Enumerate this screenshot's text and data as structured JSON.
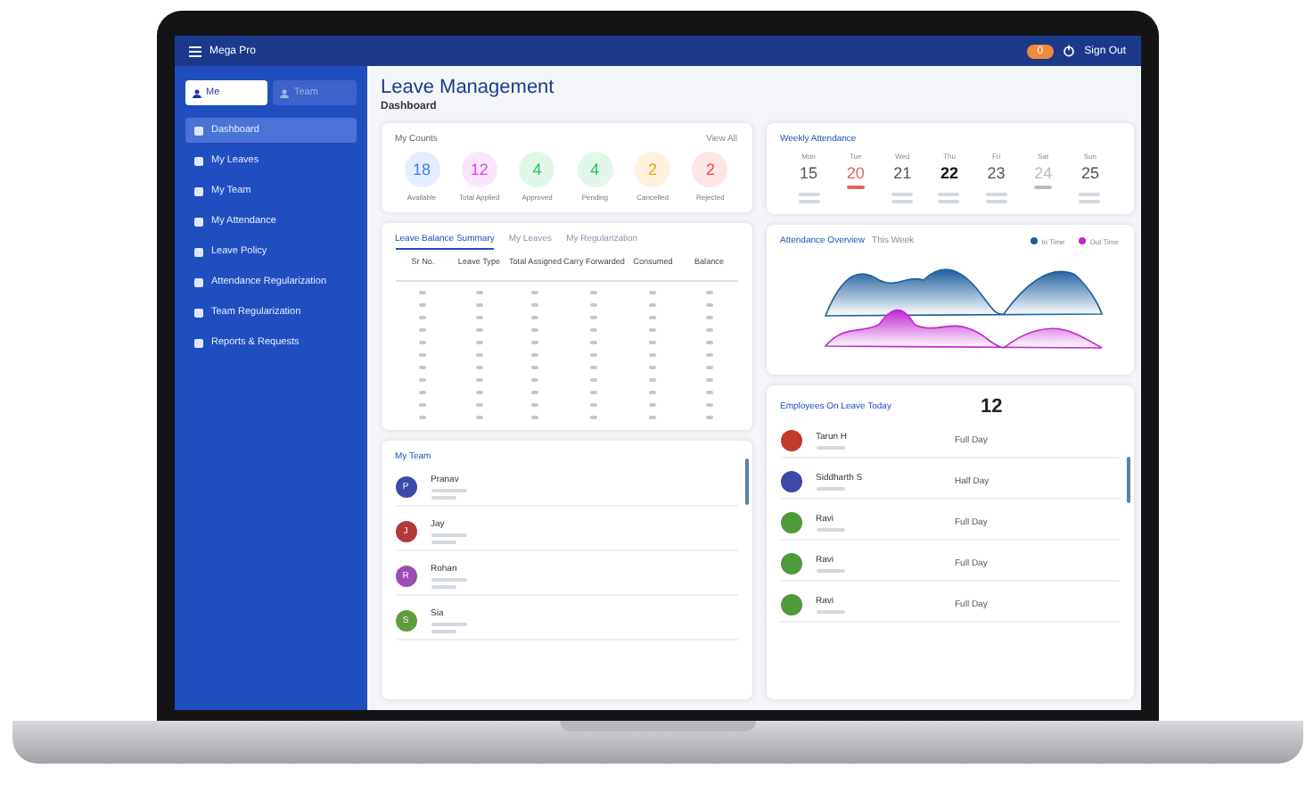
{
  "topbar": {
    "brand": "Mega Pro",
    "badge": "0",
    "user": "Sign Out"
  },
  "sidebar": {
    "toggle": [
      {
        "label": "Me",
        "selected": true
      },
      {
        "label": "Team",
        "selected": false
      }
    ],
    "items": [
      {
        "label": "Dashboard",
        "selected": true
      },
      {
        "label": "My Leaves",
        "selected": false
      },
      {
        "label": "My Team",
        "selected": false
      },
      {
        "label": "My Attendance",
        "selected": false
      },
      {
        "label": "Leave Policy",
        "selected": false
      },
      {
        "label": "Attendance Regularization",
        "selected": false
      },
      {
        "label": "Team Regularization",
        "selected": false
      },
      {
        "label": "Reports & Requests",
        "selected": false
      }
    ]
  },
  "page": {
    "title": "Leave Management",
    "subtitle": "Dashboard"
  },
  "counts": {
    "title": "My Counts",
    "action": "View All",
    "items": [
      {
        "value": "18",
        "label": "Available",
        "color": "#3b82f6"
      },
      {
        "value": "12",
        "label": "Total Applied",
        "color": "#d946ef"
      },
      {
        "value": "4",
        "label": "Approved",
        "color": "#22c55e"
      },
      {
        "value": "4",
        "label": "Pending",
        "color": "#22c55e"
      },
      {
        "value": "2",
        "label": "Cancelled",
        "color": "#f59e0b"
      },
      {
        "value": "2",
        "label": "Rejected",
        "color": "#ef4444"
      }
    ]
  },
  "summary": {
    "tabs": [
      {
        "label": "Leave Balance Summary",
        "selected": true
      },
      {
        "label": "My Leaves",
        "selected": false
      },
      {
        "label": "My Regularization",
        "selected": false
      }
    ],
    "columns": [
      "Sr No.",
      "Leave Type",
      "Total Assigned",
      "Carry Forwarded",
      "Consumed",
      "Balance"
    ]
  },
  "team": {
    "title": "My Team",
    "members": [
      {
        "initial": "P",
        "name": "Pranav",
        "color": "#3b4aa8"
      },
      {
        "initial": "J",
        "name": "Jay",
        "color": "#b23a3a"
      },
      {
        "initial": "R",
        "name": "Rohan",
        "color": "#9b4db3"
      },
      {
        "initial": "S",
        "name": "Sia",
        "color": "#5f9e3e"
      }
    ]
  },
  "weekly": {
    "title": "Weekly Attendance",
    "days": [
      {
        "day": "Mon",
        "date": "15",
        "kind": "present"
      },
      {
        "day": "Tue",
        "date": "20",
        "kind": "leave"
      },
      {
        "day": "Wed",
        "date": "21",
        "kind": "present"
      },
      {
        "day": "Thu",
        "date": "22",
        "kind": "today"
      },
      {
        "day": "Fri",
        "date": "23",
        "kind": "present"
      },
      {
        "day": "Sat",
        "date": "24",
        "kind": "holiday"
      },
      {
        "day": "Sun",
        "date": "25",
        "kind": "present"
      }
    ]
  },
  "overview": {
    "title": "Attendance Overview",
    "filter": "This Week",
    "legend": [
      {
        "label": "In Time",
        "color": "#1e5f9e"
      },
      {
        "label": "Out Time",
        "color": "#c026d3"
      }
    ]
  },
  "on_leave": {
    "title": "Employees On Leave Today",
    "count": "12",
    "rows": [
      {
        "name": "Tarun H",
        "type": "Full Day",
        "color": "#c0392b"
      },
      {
        "name": "Siddharth S",
        "type": "Half Day",
        "color": "#3b4aa8"
      },
      {
        "name": "Ravi",
        "type": "Full Day",
        "color": "#4f9a3b"
      },
      {
        "name": "Ravi",
        "type": "Full Day",
        "color": "#4f9a3b"
      },
      {
        "name": "Ravi",
        "type": "Full Day",
        "color": "#4f9a3b"
      }
    ]
  }
}
